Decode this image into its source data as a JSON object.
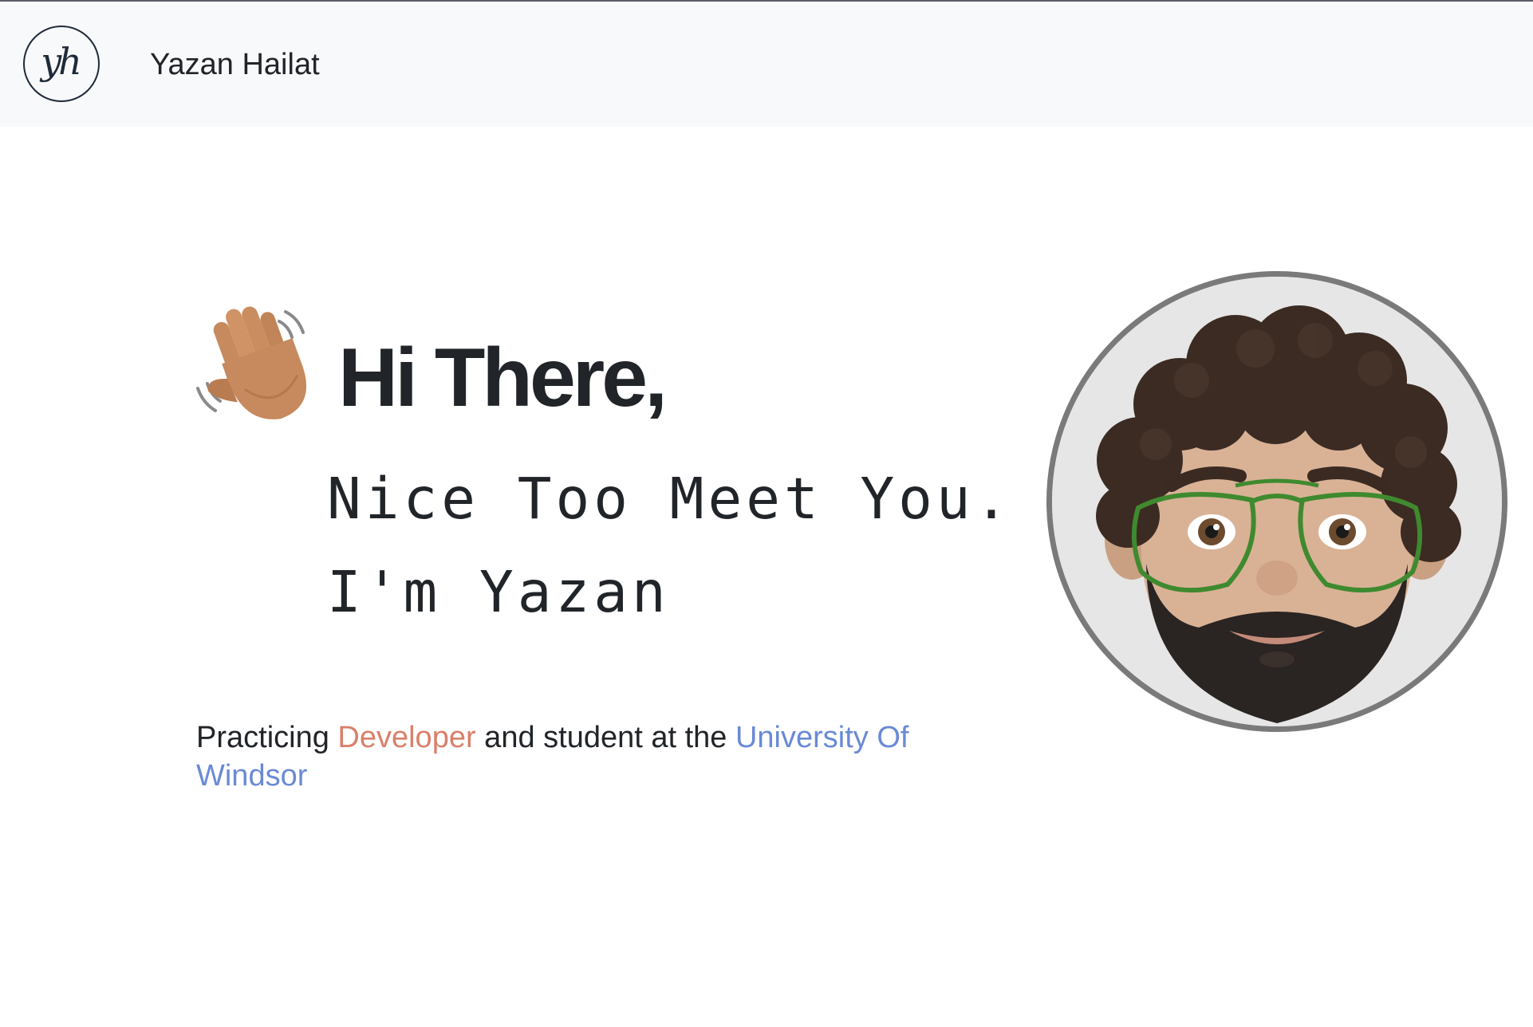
{
  "navbar": {
    "logo_text": "yh",
    "brand_name": "Yazan Hailat"
  },
  "hero": {
    "greeting": "Hi There,",
    "typed_lines": [
      "Nice Too Meet You.",
      "I'm Yazan"
    ],
    "tagline": {
      "part1": "Practicing ",
      "role": "Developer",
      "part2": " and student at the ",
      "school": "University Of Windsor"
    },
    "emoji": "waving-hand-icon",
    "avatar": "memoji-avatar"
  },
  "colors": {
    "role_accent": "#d9806a",
    "school_link": "#6a8ad6",
    "navbar_bg": "#f8f9fa",
    "text": "#212529"
  }
}
